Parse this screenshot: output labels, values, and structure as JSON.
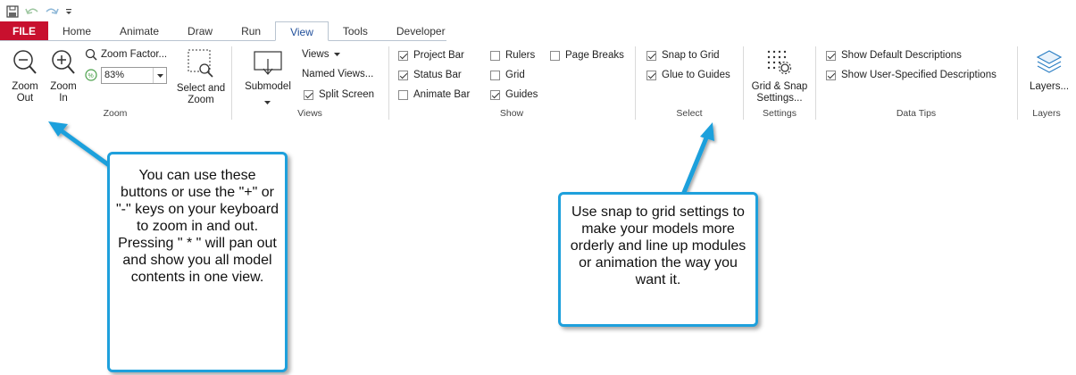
{
  "quick_access": {
    "icons": [
      "save-icon",
      "undo-icon",
      "redo-icon",
      "customize-dropdown-icon"
    ]
  },
  "tabs": [
    "FILE",
    "Home",
    "Animate",
    "Draw",
    "Run",
    "View",
    "Tools",
    "Developer"
  ],
  "active_tab": "View",
  "zoom_group": {
    "zoom_out": "Zoom Out",
    "zoom_in": "Zoom In",
    "zoom_factor": "Zoom Factor...",
    "zoom_value": "83%",
    "select_and_zoom": "Select and Zoom",
    "label": "Zoom"
  },
  "views_group": {
    "submodel": "Submodel",
    "views": "Views",
    "named_views": "Named Views...",
    "split_screen": "Split Screen",
    "split_screen_checked": true,
    "label": "Views"
  },
  "show_group": {
    "items": [
      {
        "label": "Project Bar",
        "checked": true
      },
      {
        "label": "Status Bar",
        "checked": true
      },
      {
        "label": "Animate Bar",
        "checked": false
      },
      {
        "label": "Rulers",
        "checked": false
      },
      {
        "label": "Grid",
        "checked": false
      },
      {
        "label": "Guides",
        "checked": true
      },
      {
        "label": "Page Breaks",
        "checked": false
      }
    ],
    "label": "Show"
  },
  "select_group": {
    "items": [
      {
        "label": "Snap to Grid",
        "checked": true
      },
      {
        "label": "Glue to Guides",
        "checked": true
      }
    ],
    "label": "Select"
  },
  "settings_group": {
    "button": "Grid & Snap Settings...",
    "label": "Settings"
  },
  "data_tips_group": {
    "items": [
      {
        "label": "Show Default Descriptions",
        "checked": true
      },
      {
        "label": "Show User-Specified Descriptions",
        "checked": true
      }
    ],
    "label": "Data Tips"
  },
  "layers_group": {
    "button": "Layers...",
    "label": "Layers"
  },
  "callouts": {
    "zoom": "You can use these buttons or use the \"+\" or \"-\" keys on your keyboard to zoom in and out. Pressing \" * \" will pan out and show you all model contents in one view.",
    "snap": "Use snap to grid settings to make your models more orderly and line up modules or animation the way you want it."
  },
  "colors": {
    "file_tab": "#c8102e",
    "active_tab_text": "#1f4e9a",
    "callout_border": "#1ea0dc",
    "checkbox_on": "#333333"
  }
}
